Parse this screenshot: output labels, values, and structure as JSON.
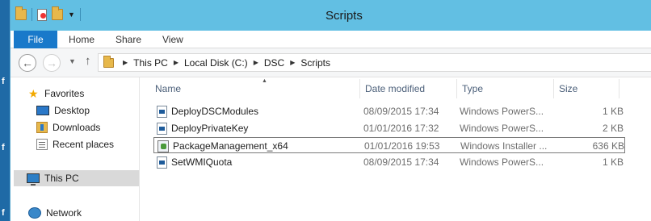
{
  "window": {
    "title": "Scripts"
  },
  "desktop_marks": [
    "f",
    "f",
    "f"
  ],
  "ribbon": {
    "tabs": [
      "File",
      "Home",
      "Share",
      "View"
    ]
  },
  "address": {
    "crumbs": [
      "This PC",
      "Local Disk (C:)",
      "DSC",
      "Scripts"
    ]
  },
  "nav": {
    "items": [
      {
        "label": "Favorites",
        "icon": "star-icon"
      },
      {
        "label": "Desktop",
        "icon": "desktop-icon"
      },
      {
        "label": "Downloads",
        "icon": "downloads-icon"
      },
      {
        "label": "Recent places",
        "icon": "recent-places-icon"
      },
      {
        "label": "This PC",
        "icon": "this-pc-icon",
        "selected": true
      },
      {
        "label": "Network",
        "icon": "network-icon"
      }
    ]
  },
  "columns": {
    "name": "Name",
    "date": "Date modified",
    "type": "Type",
    "size": "Size"
  },
  "files": [
    {
      "name": "DeployDSCModules",
      "date": "08/09/2015 17:34",
      "type": "Windows PowerS...",
      "size": "1 KB",
      "icon": "powershell-script-icon"
    },
    {
      "name": "DeployPrivateKey",
      "date": "01/01/2016 17:32",
      "type": "Windows PowerS...",
      "size": "2 KB",
      "icon": "powershell-script-icon"
    },
    {
      "name": "PackageManagement_x64",
      "date": "01/01/2016 19:53",
      "type": "Windows Installer ...",
      "size": "636 KB",
      "icon": "installer-package-icon",
      "focused": true
    },
    {
      "name": "SetWMIQuota",
      "date": "08/09/2015 17:34",
      "type": "Windows PowerS...",
      "size": "1 KB",
      "icon": "powershell-script-icon"
    }
  ],
  "colors": {
    "titlebar": "#62bfe3",
    "file_tab": "#1979ca",
    "selection": "#d9d9d9"
  }
}
